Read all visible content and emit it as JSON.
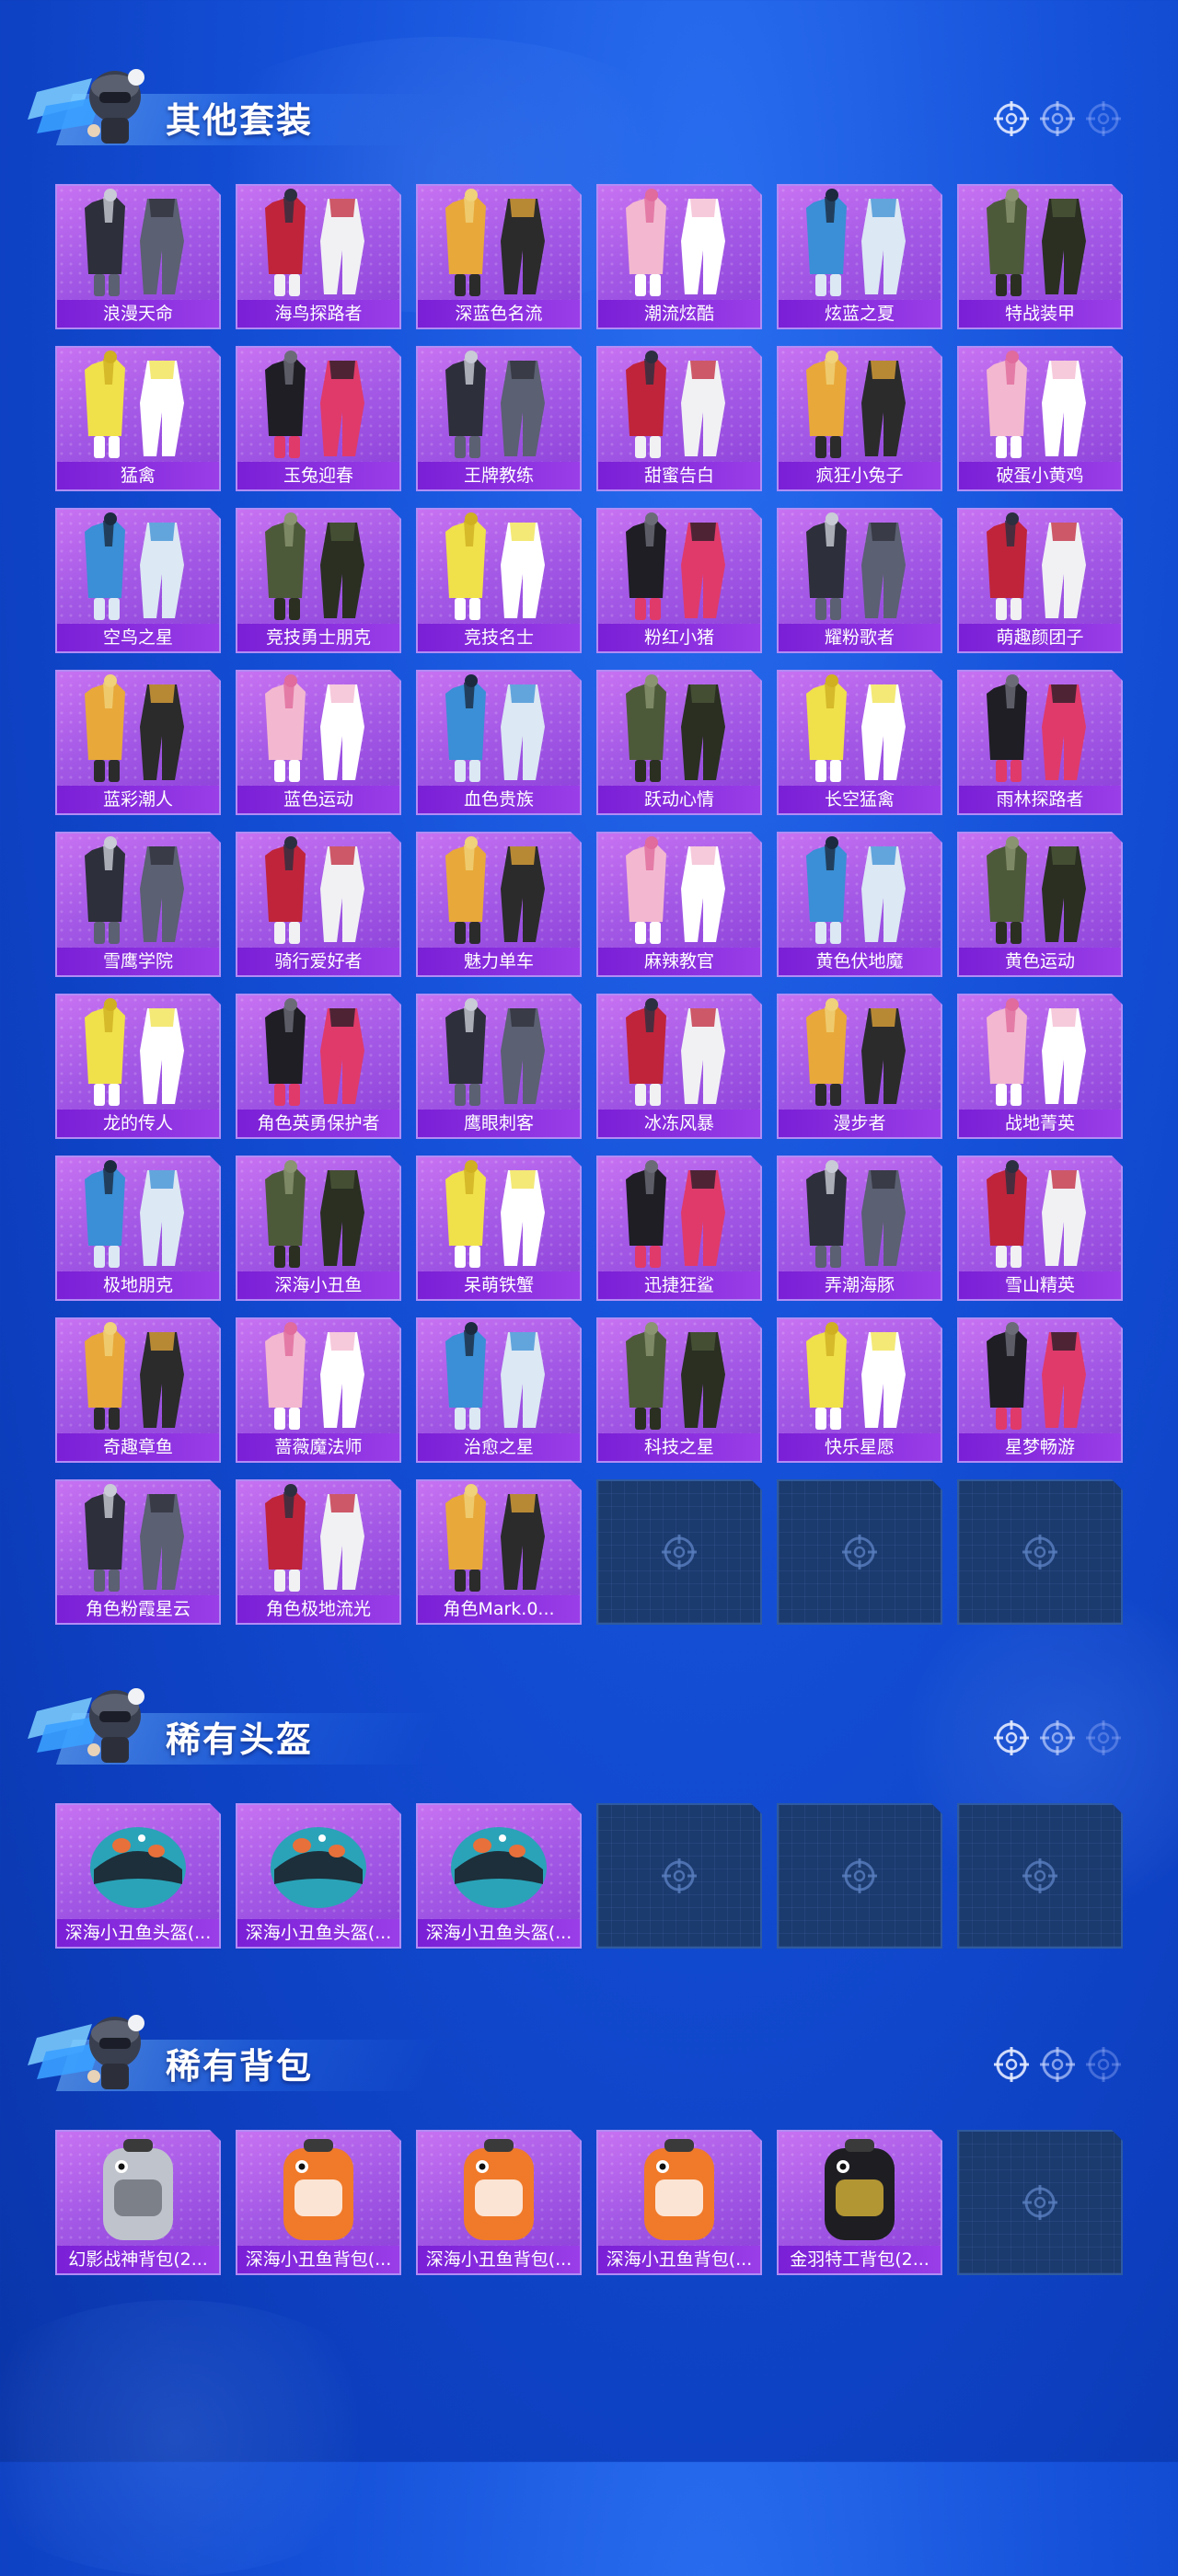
{
  "sections": [
    {
      "title": "其他套装",
      "items": [
        "浪漫天命",
        "海鸟探路者",
        "深蓝色名流",
        "潮流炫酷",
        "炫蓝之夏",
        "特战装甲",
        "猛禽",
        "玉兔迎春",
        "王牌教练",
        "甜蜜告白",
        "疯狂小兔子",
        "破蛋小黄鸡",
        "空鸟之星",
        "竞技勇士朋克",
        "竞技名士",
        "粉红小猪",
        "耀粉歌者",
        "萌趣颜团子",
        "蓝彩潮人",
        "蓝色运动",
        "血色贵族",
        "跃动心情",
        "长空猛禽",
        "雨林探路者",
        "雪鹰学院",
        "骑行爱好者",
        "魅力单车",
        "麻辣教官",
        "黄色伏地魔",
        "黄色运动",
        "龙的传人",
        "角色英勇保护者",
        "鹰眼刺客",
        "冰冻风暴",
        "漫步者",
        "战地菁英",
        "极地朋克",
        "深海小丑鱼",
        "呆萌铁蟹",
        "迅捷狂鲨",
        "弄潮海豚",
        "雪山精英",
        "奇趣章鱼",
        "蔷薇魔法师",
        "治愈之星",
        "科技之星",
        "快乐星愿",
        "星梦畅游",
        "角色粉霞星云",
        "角色极地流光",
        "角色Mark.0..."
      ],
      "empty_slots": 3
    },
    {
      "title": "稀有头盔",
      "items": [
        "深海小丑鱼头盔(...",
        "深海小丑鱼头盔(...",
        "深海小丑鱼头盔(..."
      ],
      "empty_slots": 3
    },
    {
      "title": "稀有背包",
      "items": [
        "幻影战神背包(2...",
        "深海小丑鱼背包(...",
        "深海小丑鱼背包(...",
        "深海小丑鱼背包(...",
        "金羽特工背包(2..."
      ],
      "empty_slots": 1
    }
  ],
  "colors": {
    "card_purple": "#a55ae6",
    "label_purple": "#7a1fd6",
    "empty_slot": "#1b3a6e",
    "background": "#1450d8"
  },
  "icons": {
    "header_mascot": "mascot-icon",
    "crosshair": "crosshair-icon",
    "placeholder": "crosshair-icon"
  }
}
